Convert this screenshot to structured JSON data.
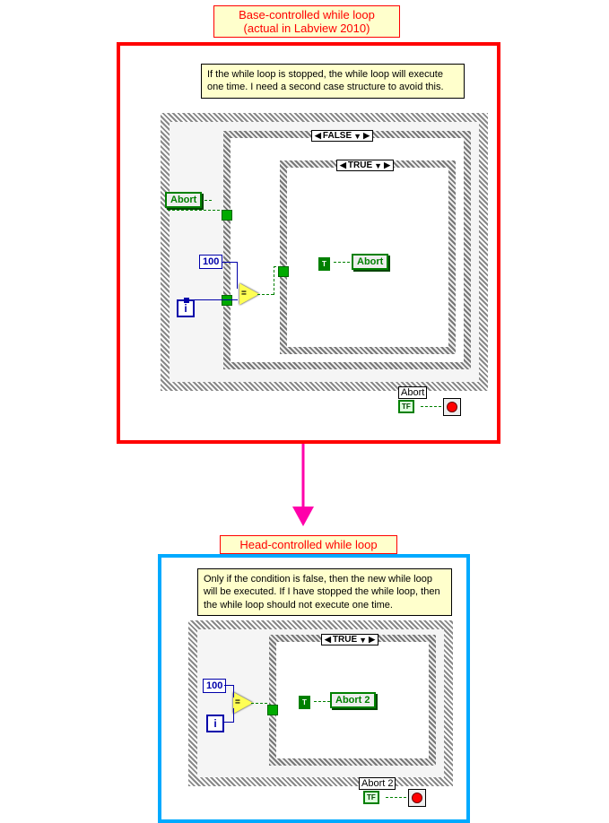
{
  "title1_line1": "Base-controlled while loop",
  "title1_line2": "(actual in Labview 2010)",
  "title2": "Head-controlled while loop",
  "comment1": "If the while loop is stopped, the while loop will execute one time. I need a second case structure to avoid this.",
  "comment2": "Only if the condition is false, then the new while loop will be executed. If I  have stopped the while loop, then the while loop should not execute one time.",
  "outer_case_sel": "FALSE",
  "inner_case_sel": "TRUE",
  "case_sel_bottom": "TRUE",
  "abort_control": "Abort",
  "const_100": "100",
  "abort_inner": "Abort",
  "abort_ind_label": "Abort",
  "abort2_inner": "Abort 2",
  "abort2_ind_label": "Abort 2",
  "i_label": "i",
  "tf_label": "TF",
  "true_short": "T"
}
